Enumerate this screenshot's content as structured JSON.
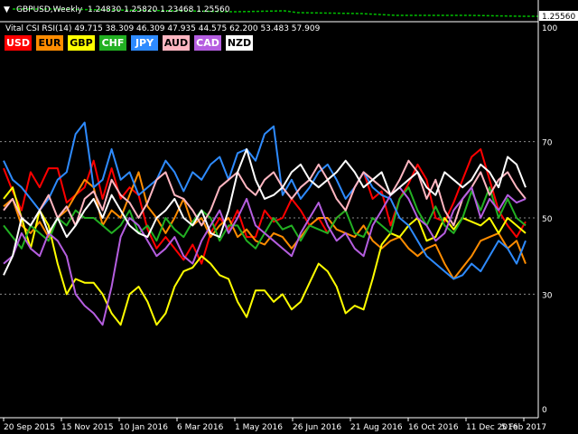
{
  "price_panel": {
    "symbol_label": "GBPUSD,Weekly",
    "ohlc": "1.24830 1.25820 1.23468 1.25560",
    "current_price": "1.25560",
    "line_color": "#00c000"
  },
  "indicator_panel": {
    "title": "Vital CSI RSI(14) 49.715 38.309 46.309 47.935 44.575 62.200 53.483 57.909",
    "y_ticks": [
      "100",
      "70",
      "50",
      "30",
      "0"
    ],
    "x_ticks": [
      "20 Sep 2015",
      "15 Nov 2015",
      "10 Jan 2016",
      "6 Mar 2016",
      "1 May 2016",
      "26 Jun 2016",
      "21 Aug 2016",
      "16 Oct 2016",
      "11 Dec 2016",
      "5 Feb 2017"
    ]
  },
  "legend": [
    {
      "name": "USD",
      "bg": "#ff0000",
      "fg": "#ffffff"
    },
    {
      "name": "EUR",
      "bg": "#ff8c00",
      "fg": "#000000"
    },
    {
      "name": "GBP",
      "bg": "#ffff00",
      "fg": "#000000"
    },
    {
      "name": "CHF",
      "bg": "#22b022",
      "fg": "#ffffff"
    },
    {
      "name": "JPY",
      "bg": "#2e8bff",
      "fg": "#ffffff"
    },
    {
      "name": "AUD",
      "bg": "#ffb6c1",
      "fg": "#000000"
    },
    {
      "name": "CAD",
      "bg": "#b55ee0",
      "fg": "#ffffff"
    },
    {
      "name": "NZD",
      "bg": "#ffffff",
      "fg": "#000000"
    }
  ],
  "chart_data": {
    "type": "line",
    "ylim": [
      0,
      100
    ],
    "grid": true,
    "x_ticks": [
      "20 Sep 2015",
      "15 Nov 2015",
      "10 Jan 2016",
      "6 Mar 2016",
      "1 May 2016",
      "26 Jun 2016",
      "21 Aug 2016",
      "16 Oct 2016",
      "11 Dec 2016",
      "5 Feb 2017"
    ],
    "series": [
      {
        "name": "USD",
        "color": "#ff0000",
        "values": [
          63,
          57,
          52,
          62,
          58,
          63,
          63,
          54,
          56,
          58,
          65,
          55,
          63,
          55,
          58,
          56,
          47,
          42,
          45,
          42,
          39,
          43,
          38,
          46,
          50,
          47,
          52,
          45,
          45,
          52,
          49,
          50,
          55,
          52,
          48,
          50,
          46,
          50,
          52,
          58,
          62,
          55,
          57,
          48,
          55,
          59,
          64,
          60,
          50,
          49,
          54,
          60,
          66,
          68,
          60,
          52,
          48,
          45,
          49
        ]
      },
      {
        "name": "EUR",
        "color": "#ff8c00",
        "values": [
          53,
          55,
          48,
          46,
          49,
          45,
          50,
          52,
          56,
          60,
          58,
          48,
          52,
          50,
          56,
          62,
          53,
          50,
          46,
          50,
          55,
          48,
          50,
          45,
          48,
          50,
          45,
          47,
          44,
          43,
          46,
          45,
          42,
          45,
          48,
          50,
          50,
          47,
          46,
          45,
          48,
          44,
          42,
          44,
          45,
          42,
          40,
          42,
          43,
          38,
          34,
          37,
          40,
          44,
          45,
          46,
          42,
          44,
          38
        ]
      },
      {
        "name": "GBP",
        "color": "#ffff00",
        "values": [
          55,
          58,
          50,
          42,
          52,
          48,
          38,
          30,
          34,
          33,
          33,
          30,
          25,
          22,
          30,
          32,
          28,
          22,
          25,
          32,
          36,
          37,
          40,
          38,
          35,
          34,
          28,
          24,
          31,
          31,
          28,
          30,
          26,
          28,
          33,
          38,
          36,
          32,
          25,
          27,
          26,
          34,
          43,
          46,
          45,
          48,
          50,
          44,
          45,
          50,
          47,
          50,
          49,
          48,
          50,
          46,
          50,
          48,
          46
        ]
      },
      {
        "name": "CHF",
        "color": "#22b022",
        "values": [
          48,
          45,
          42,
          48,
          46,
          44,
          50,
          48,
          52,
          50,
          50,
          48,
          46,
          48,
          52,
          46,
          48,
          44,
          50,
          47,
          45,
          49,
          52,
          50,
          44,
          48,
          48,
          44,
          42,
          46,
          50,
          47,
          48,
          44,
          48,
          47,
          46,
          50,
          52,
          46,
          45,
          50,
          48,
          46,
          55,
          58,
          52,
          48,
          53,
          48,
          46,
          50,
          57,
          52,
          58,
          50,
          55,
          50,
          48
        ]
      },
      {
        "name": "JPY",
        "color": "#2e8bff",
        "values": [
          65,
          60,
          58,
          55,
          52,
          55,
          60,
          62,
          72,
          75,
          58,
          60,
          68,
          60,
          62,
          56,
          58,
          60,
          65,
          62,
          57,
          62,
          60,
          64,
          66,
          60,
          67,
          68,
          65,
          72,
          74,
          56,
          60,
          55,
          58,
          62,
          64,
          60,
          55,
          58,
          62,
          58,
          56,
          55,
          50,
          48,
          44,
          40,
          38,
          36,
          34,
          35,
          38,
          36,
          40,
          44,
          42,
          38,
          44
        ]
      },
      {
        "name": "AUD",
        "color": "#ffb6c1",
        "values": [
          52,
          55,
          50,
          48,
          52,
          56,
          50,
          53,
          48,
          55,
          57,
          52,
          60,
          56,
          54,
          50,
          54,
          60,
          62,
          56,
          55,
          52,
          48,
          52,
          58,
          60,
          62,
          58,
          56,
          60,
          62,
          58,
          55,
          58,
          60,
          64,
          60,
          55,
          52,
          58,
          62,
          60,
          58,
          56,
          60,
          65,
          62,
          55,
          60,
          52,
          48,
          55,
          58,
          62,
          56,
          60,
          62,
          58,
          55
        ]
      },
      {
        "name": "CAD",
        "color": "#b55ee0",
        "values": [
          38,
          40,
          46,
          42,
          40,
          46,
          44,
          40,
          30,
          27,
          25,
          22,
          32,
          45,
          50,
          48,
          44,
          40,
          42,
          45,
          40,
          38,
          44,
          48,
          52,
          46,
          50,
          55,
          48,
          46,
          44,
          42,
          40,
          46,
          50,
          54,
          48,
          44,
          46,
          42,
          40,
          48,
          52,
          56,
          58,
          55,
          50,
          48,
          44,
          46,
          52,
          55,
          58,
          50,
          55,
          52,
          56,
          54,
          55
        ]
      },
      {
        "name": "NZD",
        "color": "#ffffff",
        "values": [
          35,
          40,
          50,
          48,
          52,
          46,
          50,
          45,
          48,
          52,
          55,
          50,
          56,
          52,
          48,
          46,
          45,
          50,
          52,
          55,
          50,
          48,
          52,
          46,
          45,
          52,
          62,
          68,
          60,
          55,
          56,
          58,
          62,
          64,
          60,
          58,
          60,
          62,
          65,
          62,
          58,
          60,
          62,
          56,
          58,
          60,
          62,
          58,
          56,
          62,
          60,
          58,
          60,
          64,
          62,
          58,
          66,
          64,
          58
        ]
      }
    ]
  }
}
